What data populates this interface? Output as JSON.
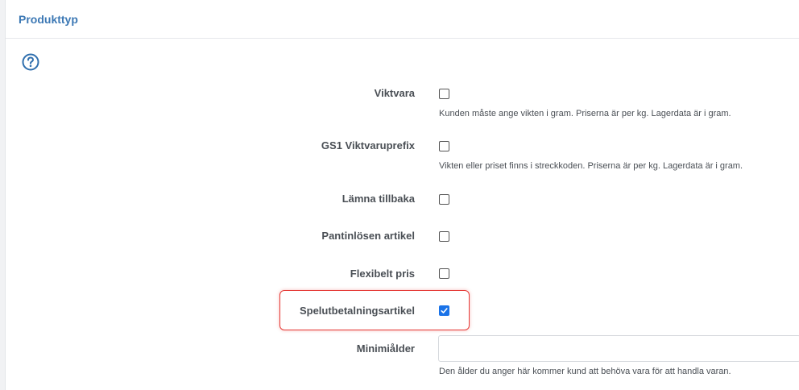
{
  "panel": {
    "title": "Produkttyp"
  },
  "fields": {
    "viktvara": {
      "label": "Viktvara",
      "checked": false,
      "help": "Kunden måste ange vikten i gram. Priserna är per kg. Lagerdata är i gram."
    },
    "gs1": {
      "label": "GS1 Viktvaruprefix",
      "checked": false,
      "help": "Vikten eller priset finns i streckkoden. Priserna är per kg. Lagerdata är i gram."
    },
    "lamna": {
      "label": "Lämna tillbaka",
      "checked": false
    },
    "pant": {
      "label": "Pantinlösen artikel",
      "checked": false
    },
    "flex": {
      "label": "Flexibelt pris",
      "checked": false
    },
    "spel": {
      "label": "Spelutbetalningsartikel",
      "checked": true
    },
    "age": {
      "label": "Minimiålder",
      "value": "",
      "placeholder": "",
      "help": "Den ålder du anger här kommer kund att behöva vara för att handla varan."
    }
  },
  "colors": {
    "accent": "#3c78b4",
    "checkbox_checked": "#1a73e8",
    "highlight": "#e53935"
  }
}
